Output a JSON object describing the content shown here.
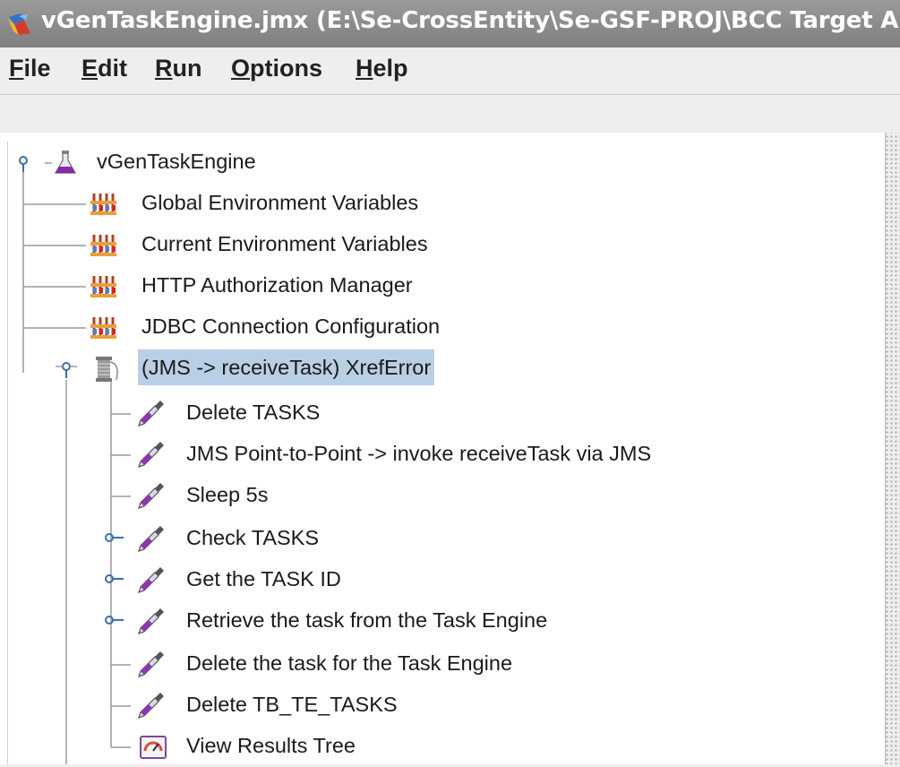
{
  "window": {
    "title": "vGenTaskEngine.jmx (E:\\Se-CrossEntity\\Se-GSF-PROJ\\BCC Target Ar"
  },
  "menu": [
    {
      "mnemonic": "F",
      "rest": "ile"
    },
    {
      "mnemonic": "E",
      "rest": "dit"
    },
    {
      "mnemonic": "R",
      "rest": "un"
    },
    {
      "mnemonic": "O",
      "rest": "ptions"
    },
    {
      "mnemonic": "H",
      "rest": "elp"
    }
  ],
  "tree": {
    "root": {
      "label": "vGenTaskEngine",
      "icon": "test-plan-flask-icon",
      "expanded": true
    },
    "config_elements": [
      {
        "label": "Global Environment Variables",
        "icon": "config-element-icon"
      },
      {
        "label": "Current Environment Variables",
        "icon": "config-element-icon"
      },
      {
        "label": "HTTP Authorization Manager",
        "icon": "config-element-icon"
      },
      {
        "label": "JDBC Connection Configuration",
        "icon": "config-element-icon"
      }
    ],
    "thread_group": {
      "label": "(JMS -> receiveTask) XrefError",
      "icon": "thread-group-spool-icon",
      "expanded": true,
      "selected": true
    },
    "samplers": [
      {
        "label": "Delete TASKS",
        "icon": "sampler-pipette-icon",
        "has_children": false
      },
      {
        "label": "JMS Point-to-Point -> invoke receiveTask via JMS",
        "icon": "sampler-pipette-icon",
        "has_children": false
      },
      {
        "label": "Sleep 5s",
        "icon": "sampler-pipette-icon",
        "has_children": false
      },
      {
        "label": "Check TASKS",
        "icon": "sampler-pipette-icon",
        "has_children": true
      },
      {
        "label": "Get the TASK ID",
        "icon": "sampler-pipette-icon",
        "has_children": true
      },
      {
        "label": "Retrieve the task from the Task Engine",
        "icon": "sampler-pipette-icon",
        "has_children": true
      },
      {
        "label": "Delete the task for the Task Engine",
        "icon": "sampler-pipette-icon",
        "has_children": false
      },
      {
        "label": "Delete TB_TE_TASKS",
        "icon": "sampler-pipette-icon",
        "has_children": false
      }
    ],
    "listener": {
      "label": "View Results Tree",
      "icon": "listener-results-icon"
    }
  }
}
